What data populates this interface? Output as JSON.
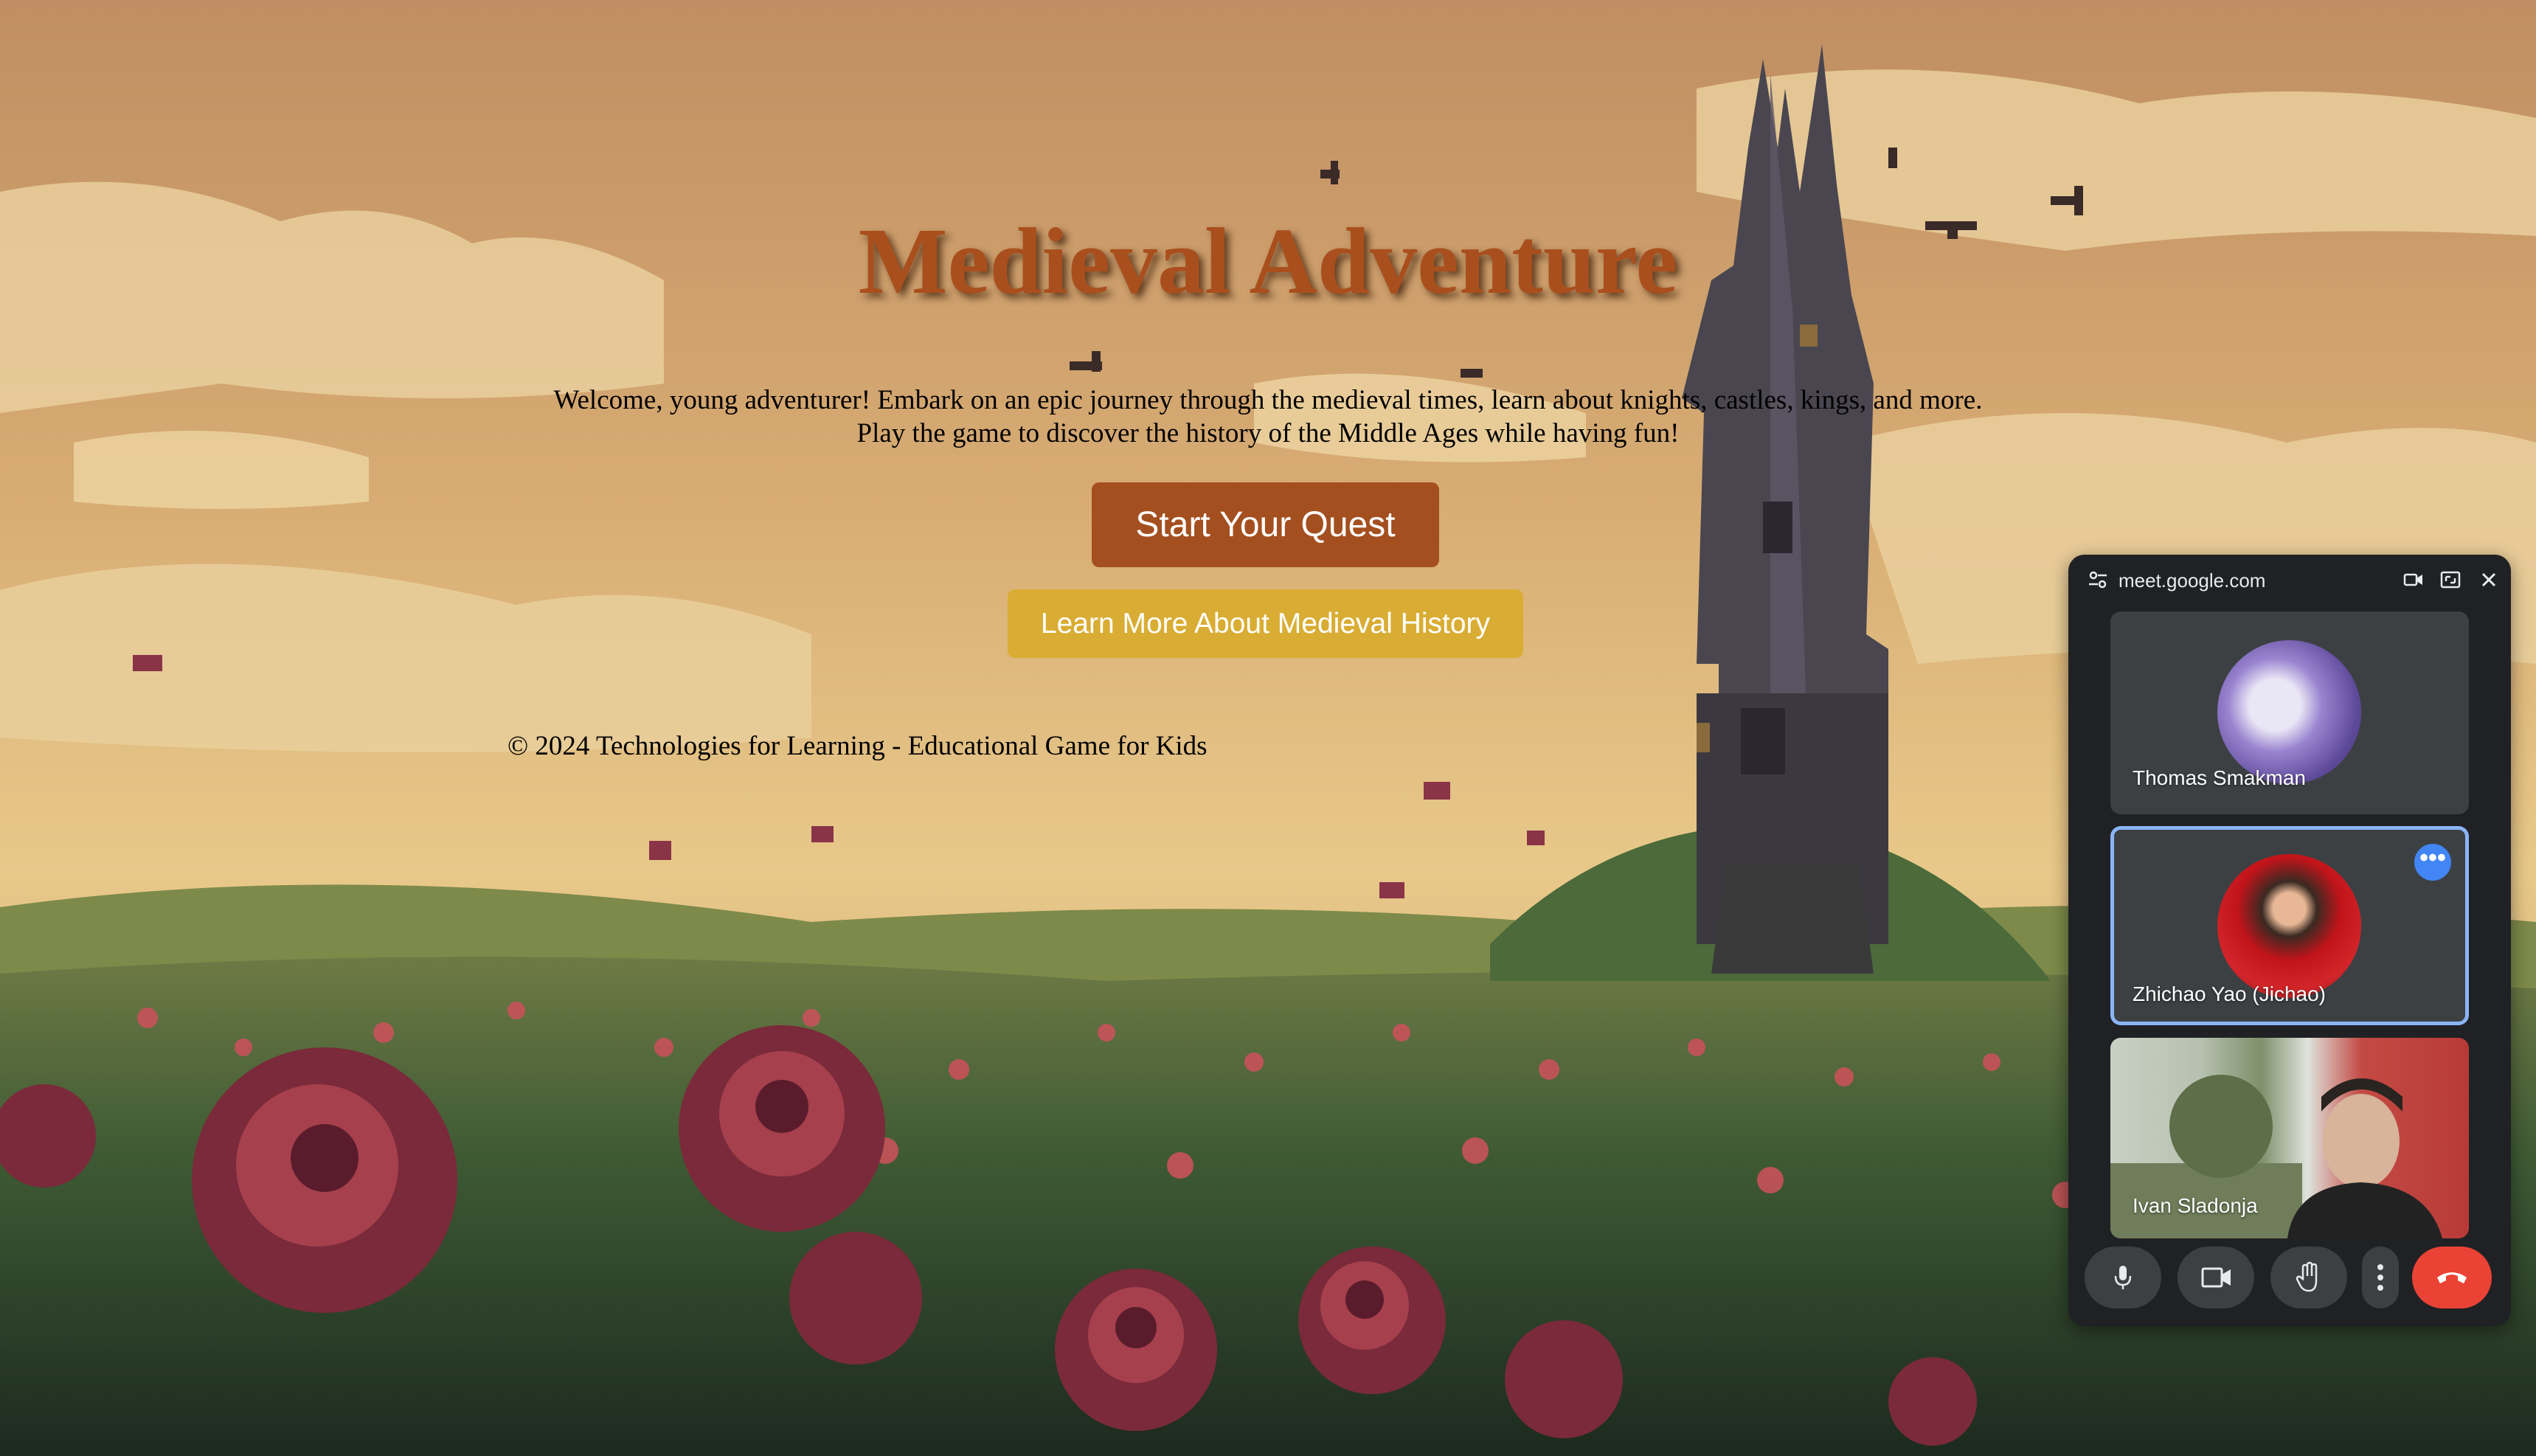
{
  "page": {
    "title": "Medieval Adventure",
    "intro_line1": "Welcome, young adventurer! Embark on an epic journey through the medieval times, learn about knights, castles, kings, and more.",
    "intro_line2": "Play the game to discover the history of the Middle Ages while having fun!",
    "start_button": "Start Your Quest",
    "learn_button": "Learn More About Medieval History",
    "footer": "© 2024 Technologies for Learning - Educational Game for Kids"
  },
  "meet": {
    "site": "meet.google.com",
    "participants": [
      {
        "name": "Thomas Smakman"
      },
      {
        "name": "Zhichao Yao (Jichao)"
      },
      {
        "name": "Ivan Sladonja"
      }
    ],
    "more_badge": "•••"
  },
  "colors": {
    "title": "#a94f1d",
    "start_button_bg": "#a44f1f",
    "learn_button_bg": "#d9ad34",
    "active_tile_border": "#8ab4f8",
    "end_call": "#ea4335"
  },
  "icons": [
    "tune-icon",
    "camera-icon",
    "expand-icon",
    "close-icon",
    "mic-icon",
    "video-icon",
    "raise-hand-icon",
    "more-vert-icon",
    "end-call-icon"
  ]
}
